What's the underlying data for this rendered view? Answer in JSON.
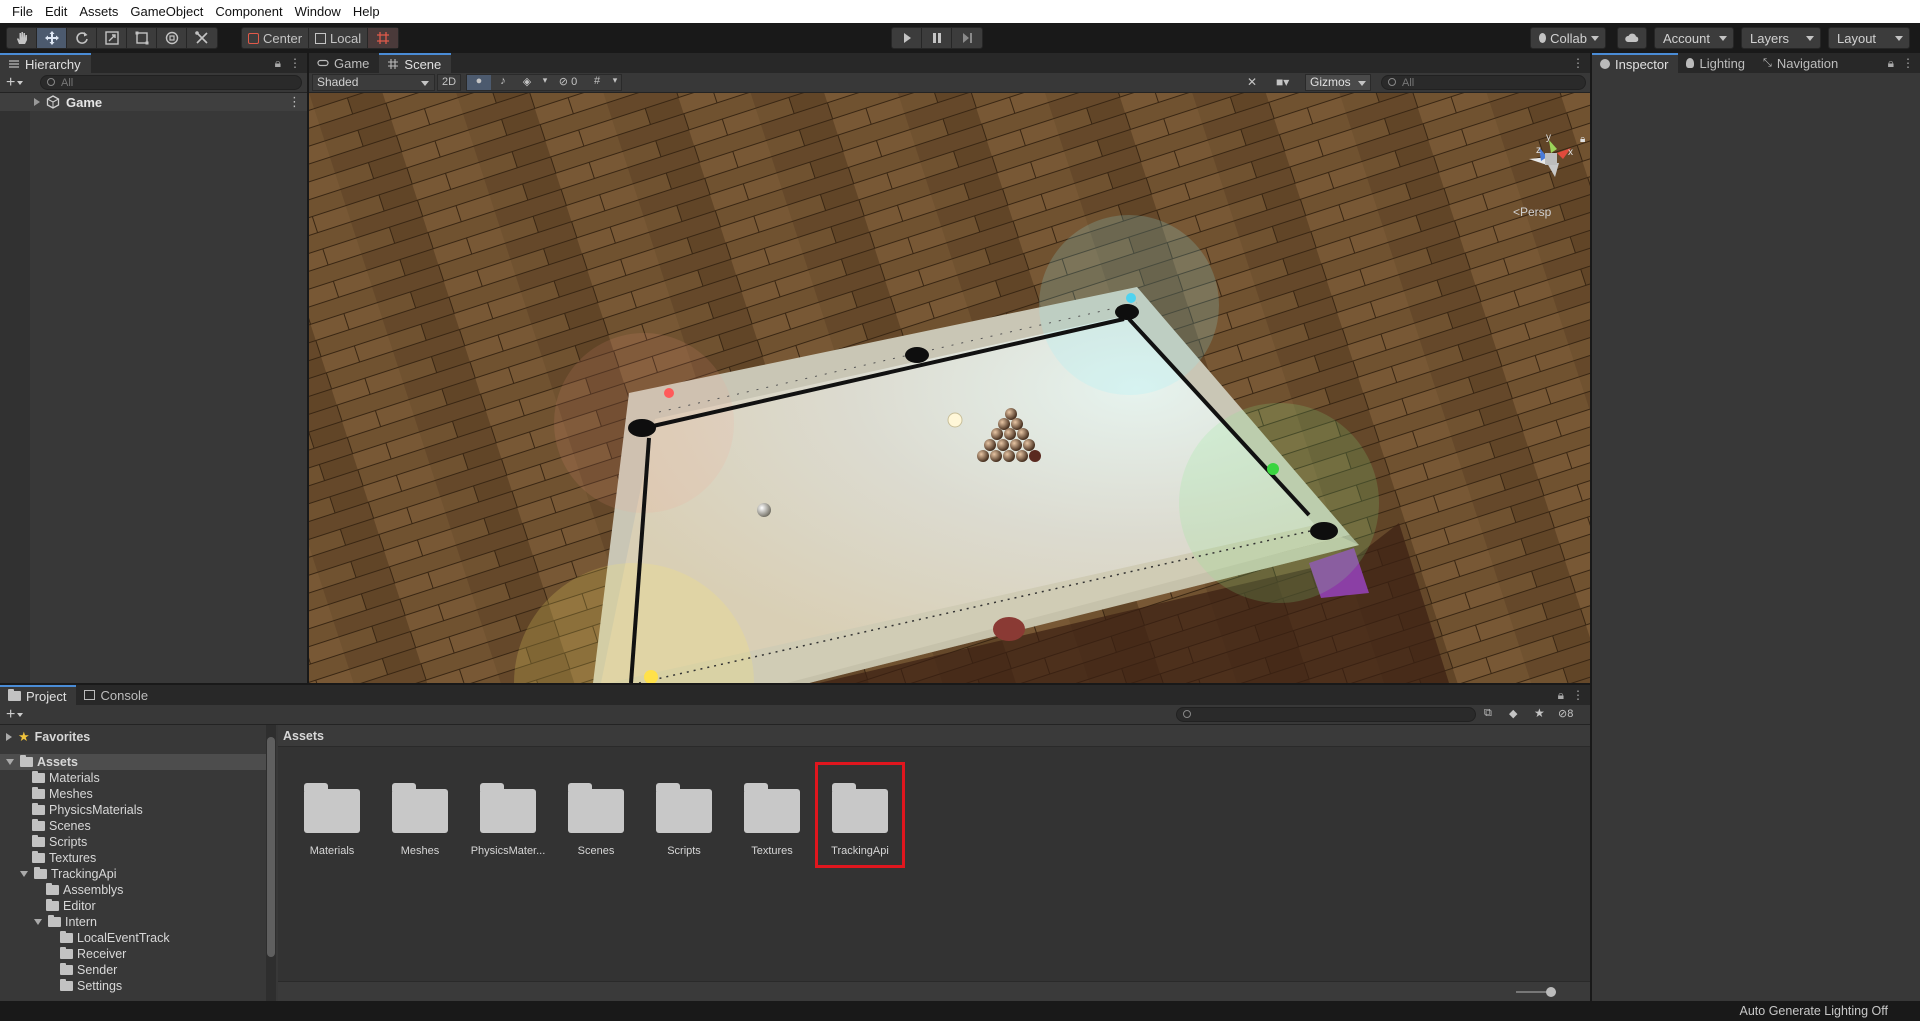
{
  "menu": [
    "File",
    "Edit",
    "Assets",
    "GameObject",
    "Component",
    "Window",
    "Help"
  ],
  "toolbar": {
    "tools": [
      "hand-icon",
      "move-icon",
      "rotate-icon",
      "scale-icon",
      "rect-icon",
      "transform-icon",
      "custom-tool-icon"
    ],
    "pivot_label": "Center",
    "space_label": "Local",
    "collab_label": "Collab",
    "account_label": "Account",
    "layers_label": "Layers",
    "layout_label": "Layout"
  },
  "hierarchy": {
    "tab": "Hierarchy",
    "search_placeholder": "All",
    "items": [
      {
        "label": "Game"
      }
    ]
  },
  "scene": {
    "tabs": [
      "Game",
      "Scene"
    ],
    "shading_mode": "Shaded",
    "mode_2d": "2D",
    "hidden_count": "0",
    "gizmos_label": "Gizmos",
    "search_placeholder": "All",
    "persp_label": "<Persp",
    "axis_labels": {
      "y": "y",
      "x": "x",
      "z": "z"
    }
  },
  "inspector": {
    "tabs": [
      "Inspector",
      "Lighting",
      "Navigation"
    ]
  },
  "project": {
    "tabs": [
      "Project",
      "Console"
    ],
    "hidden_count": "8",
    "breadcrumb": "Assets",
    "tree": [
      {
        "label": "Favorites",
        "level": 0,
        "arrow": "right",
        "icon": "star-icon"
      },
      {
        "label": "Assets",
        "level": 0,
        "arrow": "down",
        "icon": "folder-icon",
        "selected": true
      },
      {
        "label": "Materials",
        "level": 1
      },
      {
        "label": "Meshes",
        "level": 1
      },
      {
        "label": "PhysicsMaterials",
        "level": 1
      },
      {
        "label": "Scenes",
        "level": 1
      },
      {
        "label": "Scripts",
        "level": 1
      },
      {
        "label": "Textures",
        "level": 1
      },
      {
        "label": "TrackingApi",
        "level": 1,
        "arrow": "down"
      },
      {
        "label": "Assemblys",
        "level": 2
      },
      {
        "label": "Editor",
        "level": 2
      },
      {
        "label": "Intern",
        "level": 2,
        "arrow": "down"
      },
      {
        "label": "LocalEventTrack",
        "level": 3
      },
      {
        "label": "Receiver",
        "level": 3
      },
      {
        "label": "Sender",
        "level": 3
      },
      {
        "label": "Settings",
        "level": 3
      }
    ],
    "assets": [
      {
        "label": "Materials"
      },
      {
        "label": "Meshes"
      },
      {
        "label": "PhysicsMater..."
      },
      {
        "label": "Scenes"
      },
      {
        "label": "Scripts"
      },
      {
        "label": "Textures"
      },
      {
        "label": "TrackingApi",
        "highlighted": true
      }
    ]
  },
  "status": {
    "right_text": "Auto Generate Lighting Off"
  },
  "colors": {
    "highlight_box": "#e0161e",
    "selection": "#2c5d87",
    "panel": "#383838"
  }
}
